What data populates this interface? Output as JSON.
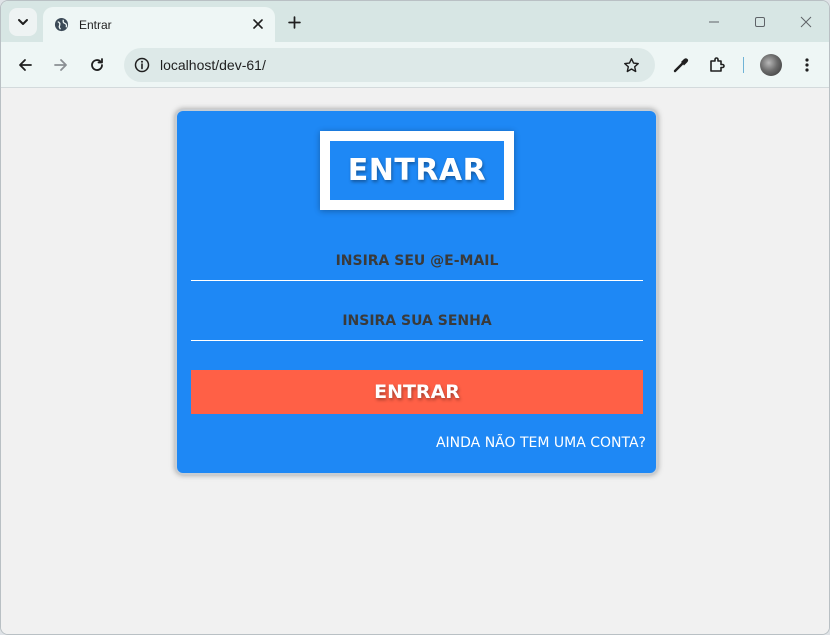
{
  "browser": {
    "tab_title": "Entrar",
    "url": "localhost/dev-61/",
    "icons": {
      "tab_search": "chevron-down-icon",
      "favicon": "globe-icon",
      "tab_close": "close-icon",
      "new_tab": "plus-icon",
      "minimize": "minimize-icon",
      "maximize": "maximize-icon",
      "close_window": "close-icon",
      "back": "arrow-left-icon",
      "forward": "arrow-right-icon",
      "reload": "reload-icon",
      "site_info": "info-icon",
      "bookmark": "star-icon",
      "eyedropper": "eyedropper-icon",
      "extensions": "puzzle-icon",
      "menu": "kebab-icon"
    }
  },
  "page": {
    "title": "ENTRAR",
    "email_placeholder": "INSIRA SEU @E-MAIL",
    "password_placeholder": "INSIRA SUA SENHA",
    "submit_label": "ENTRAR",
    "signup_link": "AINDA NÃO TEM UMA CONTA?"
  },
  "colors": {
    "card_bg": "#1e88f5",
    "submit_bg": "#ff6046",
    "page_bg": "#f1f1f1"
  }
}
